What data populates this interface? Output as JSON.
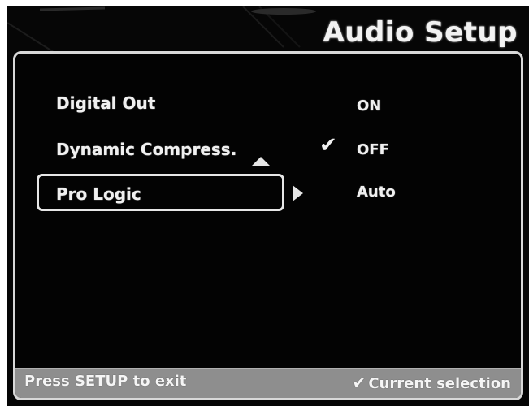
{
  "screen": {
    "title": "Audio Setup"
  },
  "menu": {
    "items": [
      {
        "label": "Digital Out"
      },
      {
        "label": "Dynamic Compress."
      },
      {
        "label": "Pro Logic",
        "selected": true
      }
    ]
  },
  "options": {
    "items": [
      {
        "label": "ON"
      },
      {
        "label": "OFF",
        "current": true
      },
      {
        "label": "Auto"
      }
    ],
    "current_marker": "✔"
  },
  "footer": {
    "exit_hint": "Press SETUP to exit",
    "legend_marker": "✔",
    "legend_label": "Current selection"
  },
  "icons": {
    "scroll_up": "up-arrow-icon",
    "submenu": "right-arrow-icon",
    "current": "checkmark-icon"
  },
  "colors": {
    "screen_background": "#050505",
    "text": "#f0f0f0",
    "footer_bar": "#8e8e8e",
    "frame": "#e6e6e6"
  }
}
